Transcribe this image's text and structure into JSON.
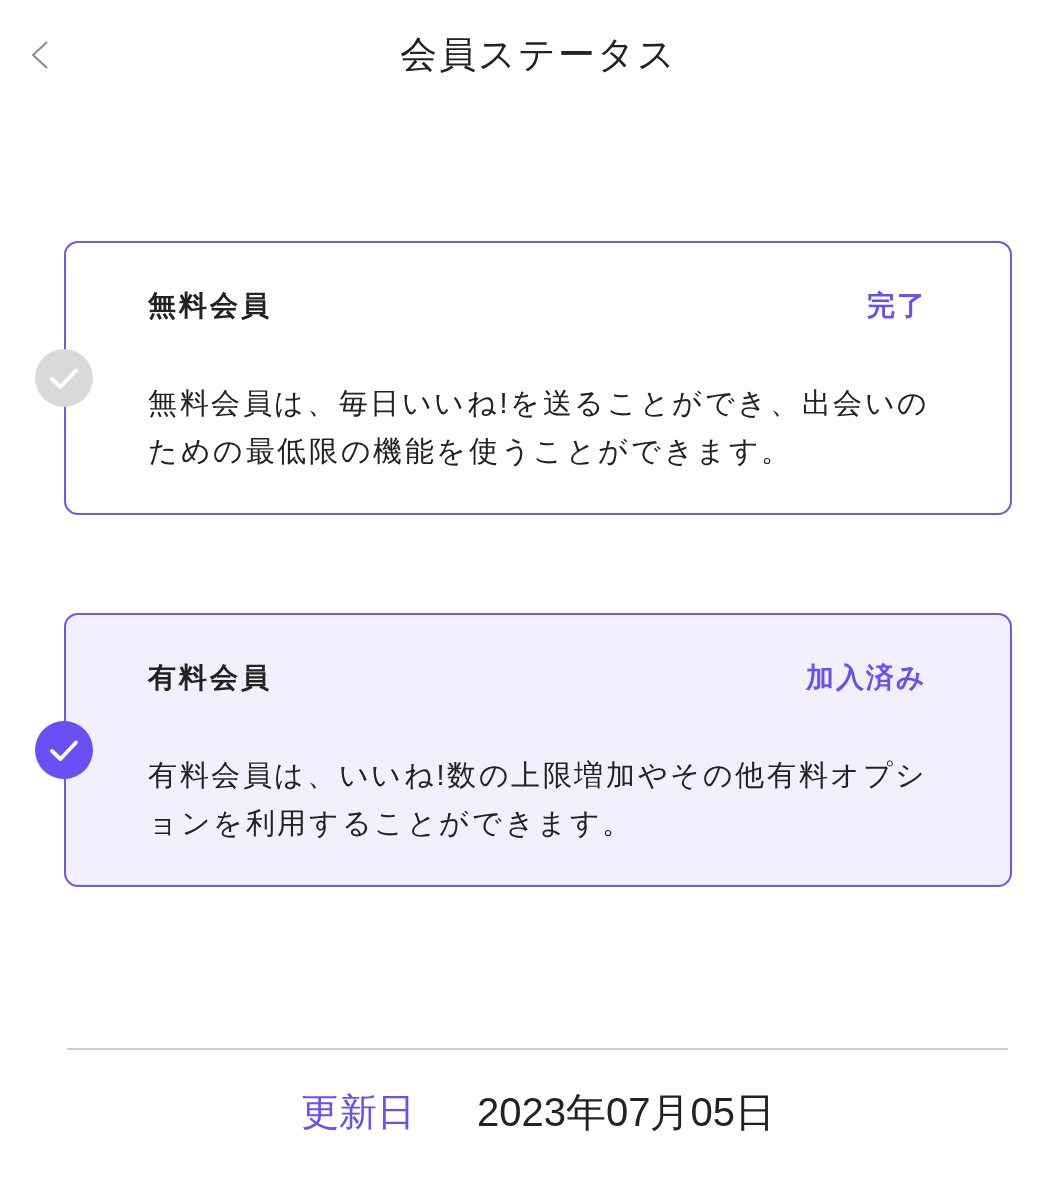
{
  "header": {
    "title": "会員ステータス"
  },
  "plans": [
    {
      "name": "無料会員",
      "status": "完了",
      "description": "無料会員は、毎日いいね!を送ることができ、出会いのための最低限の機能を使うことができます。",
      "selected": false
    },
    {
      "name": "有料会員",
      "status": "加入済み",
      "description": "有料会員は、いいね!数の上限増加やその他有料オプションを利用することができます。",
      "selected": true
    }
  ],
  "updated": {
    "label": "更新日",
    "value": "2023年07月05日"
  }
}
